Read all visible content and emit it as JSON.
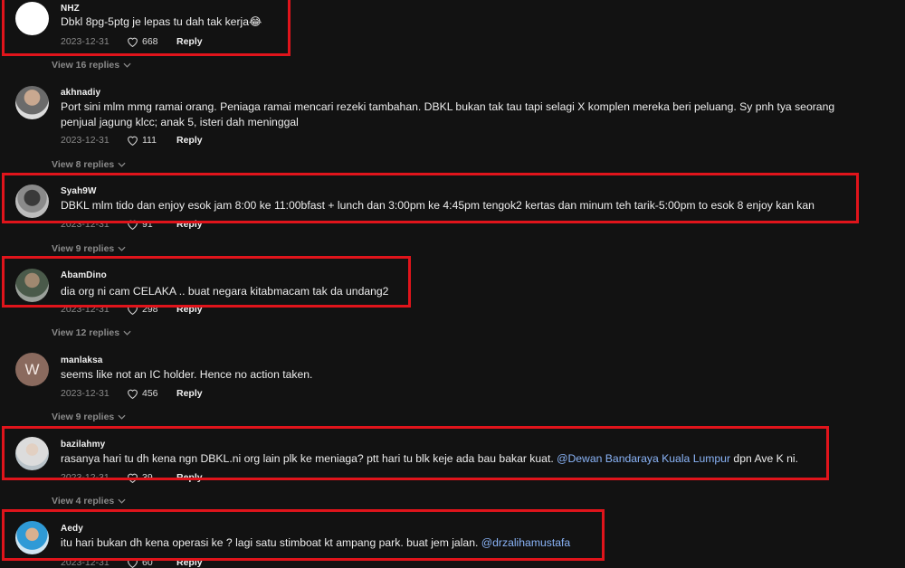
{
  "comments": [
    {
      "username": "NHZ",
      "text": "Dbkl 8pg-5ptg je lepas tu dah tak kerja😂",
      "date": "2023-12-31",
      "likes": "668",
      "reply": "Reply",
      "view_replies": "View 16 replies"
    },
    {
      "username": "akhnadiy",
      "text": "Port sini mlm mmg ramai orang. Peniaga ramai mencari rezeki tambahan. DBKL bukan tak tau tapi selagi X komplen mereka beri peluang. Sy pnh tya seorang penjual jagung klcc; anak 5, isteri dah meninggal",
      "date": "2023-12-31",
      "likes": "111",
      "reply": "Reply",
      "view_replies": "View 8 replies"
    },
    {
      "username": "Syah9W",
      "text": "DBKL mlm tido dan enjoy esok jam 8:00 ke 11:00bfast + lunch dan 3:00pm ke 4:45pm tengok2 kertas dan minum teh tarik-5:00pm to esok 8 enjoy kan kan",
      "date": "2023-12-31",
      "likes": "91",
      "reply": "Reply",
      "view_replies": "View 9 replies"
    },
    {
      "username": "AbamDino",
      "text": "dia org ni cam CELAKA .. buat negara kitabmacam tak da undang2",
      "date": "2023-12-31",
      "likes": "298",
      "reply": "Reply",
      "view_replies": "View 12 replies"
    },
    {
      "username": "manlaksa",
      "avatar_letter": "W",
      "text": "seems like not an IC holder. Hence no action taken.",
      "date": "2023-12-31",
      "likes": "456",
      "reply": "Reply",
      "view_replies": "View 9 replies"
    },
    {
      "username": "bazilahmy",
      "text": "rasanya hari tu dh kena ngn DBKL.ni org lain plk ke meniaga? ptt hari tu blk keje ada bau bakar kuat.",
      "mention": "@Dewan Bandaraya Kuala Lumpur",
      "text_after": "dpn Ave K ni.",
      "date": "2023-12-31",
      "likes": "39",
      "reply": "Reply",
      "view_replies": "View 4 replies"
    },
    {
      "username": "Aedy",
      "text": "itu hari bukan dh kena operasi ke ? lagi satu stimboat kt ampang park. buat jem jalan.",
      "mention": "@drzalihamustafa",
      "date": "2023-12-31",
      "likes": "60",
      "reply": "Reply"
    }
  ],
  "colors": {
    "highlight": "#e0141b",
    "mention": "#8ab4f8",
    "background": "#121212"
  }
}
